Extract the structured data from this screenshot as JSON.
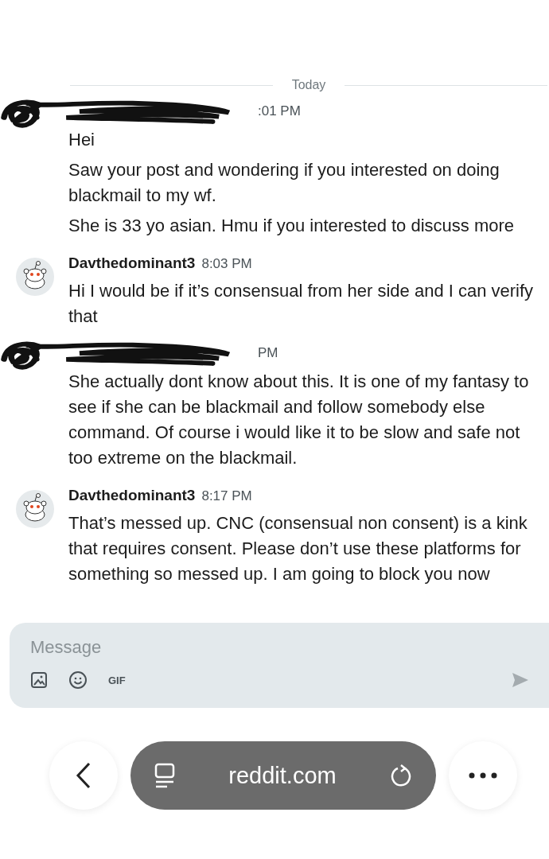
{
  "divider": {
    "label": "Today"
  },
  "messages": [
    {
      "kind": "redacted",
      "time": ":01 PM",
      "lines": [
        "Hei",
        "Saw your post and wondering if you interested on doing blackmail to my wf.",
        "She is 33 yo asian. Hmu if you interested to discuss more"
      ]
    },
    {
      "kind": "named",
      "author": "Davthedominant3",
      "time": "8:03 PM",
      "lines": [
        "Hi I would be if it’s consensual from her side and I can verify that"
      ]
    },
    {
      "kind": "redacted",
      "time": "PM",
      "lines": [
        "She actually dont know about this. It is one of my fantasy to see if she can be blackmail and follow somebody else command. Of course i would like it to be slow and safe not too extreme on the blackmail."
      ]
    },
    {
      "kind": "named",
      "author": "Davthedominant3",
      "time": "8:17 PM",
      "lines": [
        "That’s messed up. CNC (consensual non consent) is a kink that requires consent. Please don’t use these platforms for something so messed up. I am going to block you now"
      ]
    }
  ],
  "composer": {
    "placeholder": "Message",
    "gif": "GIF"
  },
  "browser": {
    "url": "reddit.com"
  }
}
